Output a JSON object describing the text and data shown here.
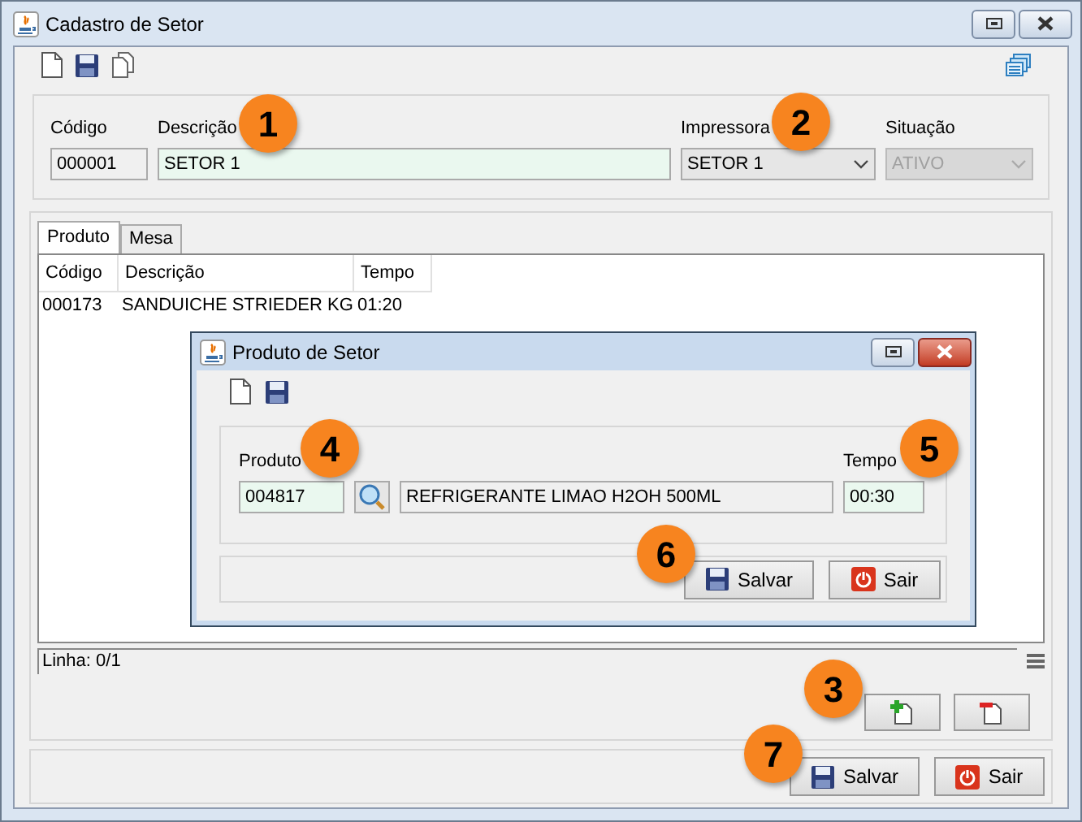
{
  "window": {
    "title": "Cadastro de Setor"
  },
  "form": {
    "fields": [
      {
        "label": "Código",
        "value": "000001",
        "kind": "text",
        "disabled": false
      },
      {
        "label": "Descrição",
        "value": "SETOR 1",
        "kind": "text",
        "disabled": false
      },
      {
        "label": "Impressora",
        "value": "SETOR 1",
        "kind": "combo",
        "disabled": false
      },
      {
        "label": "Situação",
        "value": "ATIVO",
        "kind": "combo",
        "disabled": true
      }
    ]
  },
  "tabs": [
    {
      "label": "Produto",
      "selected": true
    },
    {
      "label": "Mesa",
      "selected": false
    }
  ],
  "table": {
    "columns": [
      "Código",
      "Descrição",
      "Tempo"
    ],
    "rows": [
      [
        "000173",
        "SANDUICHE STRIEDER KG",
        "01:20"
      ]
    ]
  },
  "status": "Linha: 0/1",
  "buttons": [
    {
      "label": "Salvar",
      "kind": "save"
    },
    {
      "label": "Sair",
      "kind": "exit"
    }
  ],
  "dialog": {
    "title": "Produto de Setor",
    "product_label": "Produto",
    "product_code": "004817",
    "product_name": "REFRIGERANTE LIMAO H2OH 500ML",
    "time_label": "Tempo",
    "time": "00:30",
    "buttons": [
      {
        "label": "Salvar",
        "kind": "save"
      },
      {
        "label": "Sair",
        "kind": "exit"
      }
    ]
  },
  "callouts": [
    "1",
    "2",
    "3",
    "4",
    "5",
    "6",
    "7"
  ]
}
